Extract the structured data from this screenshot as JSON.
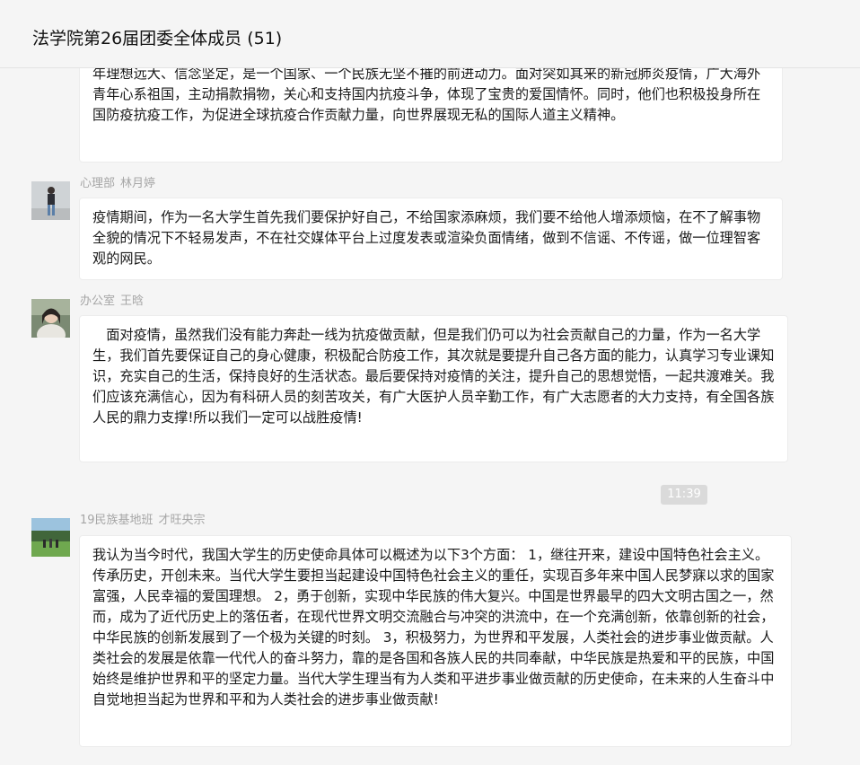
{
  "header": {
    "title": "法学院第26届团委全体成员 (51)"
  },
  "messages": [
    {
      "text": "年理想远大、信念坚定，是一个国家、一个民族无坚不摧的前进动力。面对突如其来的新冠肺炎疫情，广大海外青年心系祖国，主动捐款捐物，关心和支持国内抗疫斗争，体现了宝贵的爱国情怀。同时，他们也积极投身所在国防疫抗疫工作，为促进全球抗疫合作贡献力量，向世界展现无私的国际人道主义精神。"
    },
    {
      "dept": "心理部",
      "name": "林月婷",
      "text": "疫情期间，作为一名大学生首先我们要保护好自己，不给国家添麻烦，我们要不给他人增添烦恼，在不了解事物全貌的情况下不轻易发声，不在社交媒体平台上过度发表或渲染负面情绪，做到不信谣、不传谣，做一位理智客观的网民。"
    },
    {
      "dept": "办公室",
      "name": "王晗",
      "text": "　面对疫情，虽然我们没有能力奔赴一线为抗疫做贡献，但是我们仍可以为社会贡献自己的力量，作为一名大学生，我们首先要保证自己的身心健康，积极配合防疫工作，其次就是要提升自己各方面的能力，认真学习专业课知识，充实自己的生活，保持良好的生活状态。最后要保持对疫情的关注，提升自己的思想觉悟，一起共渡难关。我们应该充满信心，因为有科研人员的刻苦攻关，有广大医护人员辛勤工作，有广大志愿者的大力支持，有全国各族人民的鼎力支撑!所以我们一定可以战胜疫情!"
    },
    {
      "dept": "19民族基地班",
      "name": "才旺央宗",
      "text": "我认为当今时代，我国大学生的历史使命具体可以概述为以下3个方面： 1，继往开来，建设中国特色社会主义。传承历史，开创未来。当代大学生要担当起建设中国特色社会主义的重任，实现百多年来中国人民梦寐以求的国家富强，人民幸福的爱国理想。 2，勇于创新，实现中华民族的伟大复兴。中国是世界最早的四大文明古国之一，然而，成为了近代历史上的落伍者，在现代世界文明交流融合与冲突的洪流中，在一个充满创新，依靠创新的社会，中华民族的创新发展到了一个极为关键的时刻。 3，积极努力，为世界和平发展，人类社会的进步事业做贡献。人类社会的发展是依靠一代代人的奋斗努力，靠的是各国和各族人民的共同奉献，中华民族是热爱和平的民族，中国始终是维护世界和平的坚定力量。当代大学生理当有为人类和平进步事业做贡献的历史使命，在未来的人生奋斗中自觉地担当起为世界和平和为人类社会的进步事业做贡献!"
    }
  ],
  "timestamp": "11:39"
}
